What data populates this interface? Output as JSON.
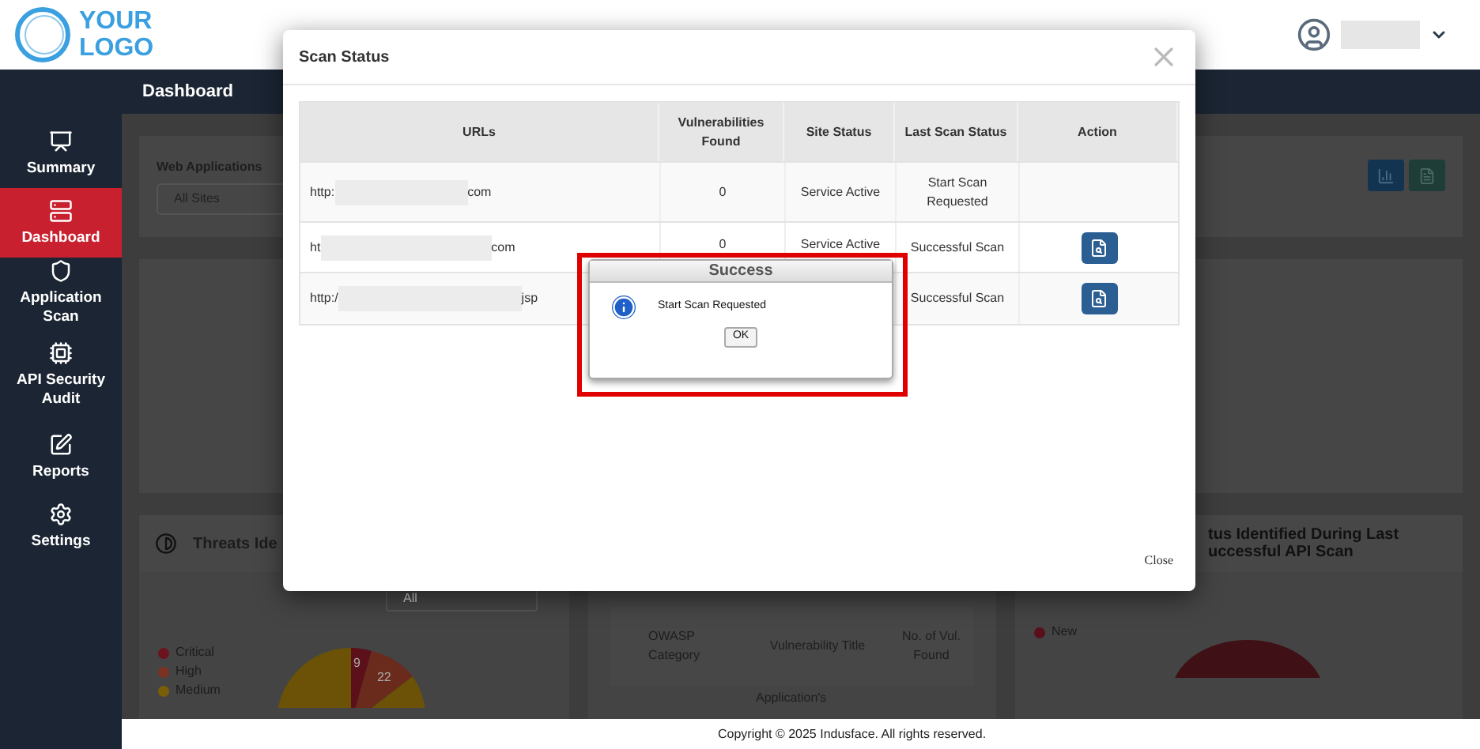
{
  "header": {
    "logo_line_1": "YOUR",
    "logo_line_2": "LOGO"
  },
  "sidebar": {
    "items": [
      {
        "label": "Summary",
        "selected": false
      },
      {
        "label": "Dashboard",
        "selected": true
      },
      {
        "label": "Application Scan",
        "selected": false
      },
      {
        "label": "API Security Audit",
        "selected": false
      },
      {
        "label": "Reports",
        "selected": false
      },
      {
        "label": "Settings",
        "selected": false
      }
    ]
  },
  "page_title": "Dashboard",
  "filters": {
    "label": "Web Applications",
    "value": "All Sites"
  },
  "threats_card": {
    "title": "Threats Ide",
    "select_value": "All",
    "legend": [
      {
        "label": "Critical",
        "color": "#6b1420"
      },
      {
        "label": "High",
        "color": "#7a3222"
      },
      {
        "label": "Medium",
        "color": "#7a5e0a"
      }
    ],
    "pie_labels": [
      "9",
      "22"
    ]
  },
  "owasp_table": {
    "columns": [
      "OWASP Category",
      "Vulnerability Title",
      "No. of Vul. Found"
    ],
    "row_text": "Application's"
  },
  "api_card": {
    "title_lines": [
      "tus Identified During Last",
      "uccessful API Scan"
    ],
    "legend": [
      {
        "label": "New",
        "color": "#5a0f1c"
      }
    ]
  },
  "modal": {
    "title": "Scan Status",
    "close_label": "Close",
    "columns": [
      "URLs",
      "Vulnerabilities Found",
      "Site Status",
      "Last Scan Status",
      "Action"
    ],
    "rows": [
      {
        "url_prefix": "http:",
        "url_suffix": "com",
        "vulnerabilities": "0",
        "site_status": "Service Active",
        "last_scan_status": "Start Scan Requested",
        "has_action": false
      },
      {
        "url_prefix": "ht",
        "url_suffix": "com",
        "vulnerabilities": "0",
        "site_status": "Service Active",
        "last_scan_status": "Successful Scan",
        "has_action": true
      },
      {
        "url_prefix": "http:/",
        "url_suffix": "jsp",
        "last_scan_status": "Successful Scan",
        "has_action": true
      }
    ]
  },
  "alert": {
    "title": "Success",
    "message": "Start Scan Requested",
    "button": "OK"
  },
  "footer": "Copyright © 2025 Indusface. All rights reserved."
}
